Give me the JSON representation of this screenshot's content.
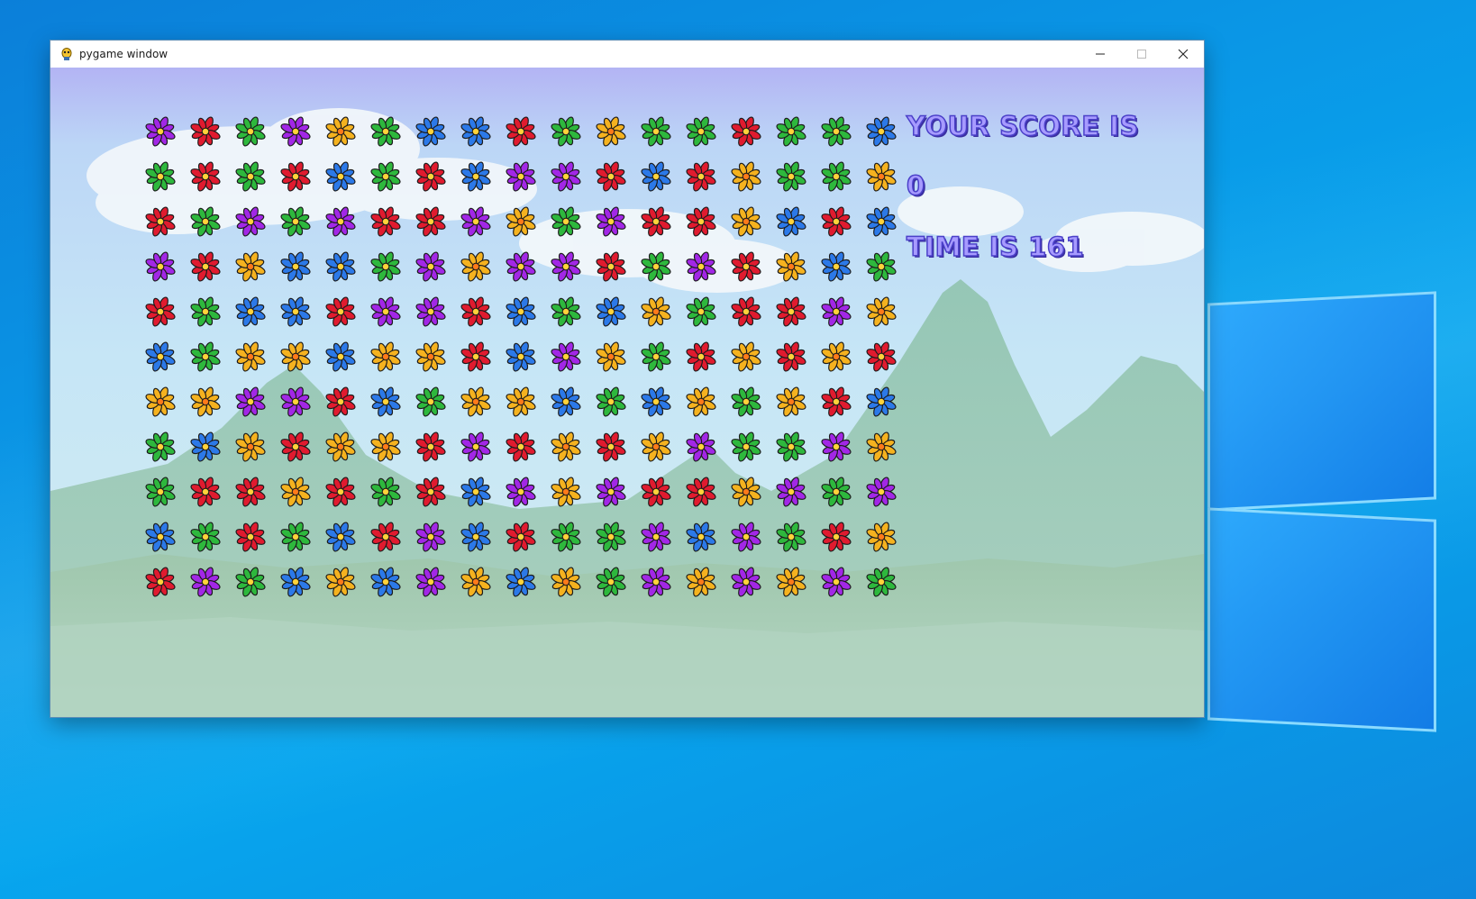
{
  "window": {
    "title": "pygame window",
    "controls": {
      "minimize_icon": "minimize-icon",
      "maximize_icon": "maximize-icon",
      "close_icon": "close-icon"
    }
  },
  "hud": {
    "score_label": "YOUR SCORE IS",
    "score_value": "0",
    "time_text": "TIME IS 161"
  },
  "colors": {
    "red": "#e01b2f",
    "green": "#2eb83d",
    "blue": "#2c79e8",
    "purple": "#a227e6",
    "yellow": "#f5b21f",
    "hud_fill": "#a79bff",
    "hud_stroke": "#4b40c9",
    "desktop": "#0a97e6"
  },
  "board": {
    "columns": 17,
    "rows": 11,
    "tiles": [
      [
        "purple",
        "red",
        "green",
        "purple",
        "yellow",
        "green",
        "blue",
        "blue",
        "red",
        "green",
        "yellow",
        "green",
        "green",
        "red",
        "green",
        "green",
        "blue"
      ],
      [
        "green",
        "red",
        "green",
        "red",
        "blue",
        "green",
        "red",
        "blue",
        "purple",
        "purple",
        "red",
        "blue",
        "red",
        "yellow",
        "green",
        "green",
        "yellow"
      ],
      [
        "red",
        "green",
        "purple",
        "green",
        "purple",
        "red",
        "red",
        "purple",
        "yellow",
        "green",
        "purple",
        "red",
        "red",
        "yellow",
        "blue",
        "red",
        "blue"
      ],
      [
        "purple",
        "red",
        "yellow",
        "blue",
        "blue",
        "green",
        "purple",
        "yellow",
        "purple",
        "purple",
        "red",
        "green",
        "purple",
        "red",
        "yellow",
        "blue",
        "green"
      ],
      [
        "red",
        "green",
        "blue",
        "blue",
        "red",
        "purple",
        "purple",
        "red",
        "blue",
        "green",
        "blue",
        "yellow",
        "green",
        "red",
        "red",
        "purple",
        "yellow"
      ],
      [
        "blue",
        "green",
        "yellow",
        "yellow",
        "blue",
        "yellow",
        "yellow",
        "red",
        "blue",
        "purple",
        "yellow",
        "green",
        "red",
        "yellow",
        "red",
        "yellow",
        "red"
      ],
      [
        "yellow",
        "yellow",
        "purple",
        "purple",
        "red",
        "blue",
        "green",
        "yellow",
        "yellow",
        "blue",
        "green",
        "blue",
        "yellow",
        "green",
        "yellow",
        "red",
        "blue"
      ],
      [
        "green",
        "blue",
        "yellow",
        "red",
        "yellow",
        "yellow",
        "red",
        "purple",
        "red",
        "yellow",
        "red",
        "yellow",
        "purple",
        "green",
        "green",
        "purple",
        "yellow"
      ],
      [
        "green",
        "red",
        "red",
        "yellow",
        "red",
        "green",
        "red",
        "blue",
        "purple",
        "yellow",
        "purple",
        "red",
        "red",
        "yellow",
        "purple",
        "green",
        "purple"
      ],
      [
        "blue",
        "green",
        "red",
        "green",
        "blue",
        "red",
        "purple",
        "blue",
        "red",
        "green",
        "green",
        "purple",
        "blue",
        "purple",
        "green",
        "red",
        "yellow"
      ],
      [
        "red",
        "purple",
        "green",
        "blue",
        "yellow",
        "blue",
        "purple",
        "yellow",
        "blue",
        "yellow",
        "green",
        "purple",
        "yellow",
        "purple",
        "yellow",
        "purple",
        "green"
      ]
    ]
  }
}
